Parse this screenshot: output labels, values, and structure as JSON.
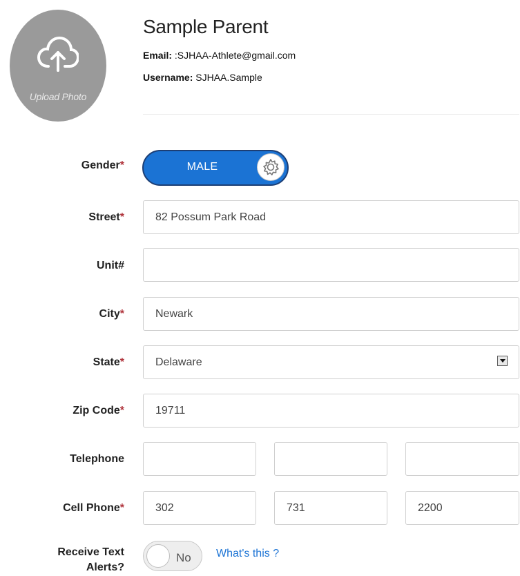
{
  "avatar": {
    "upload_label": "Upload Photo",
    "icon": "cloud-upload-icon"
  },
  "profile": {
    "name": "Sample Parent",
    "email_label": "Email:",
    "email_value": ":SJHAA-Athlete@gmail.com",
    "username_label": "Username:",
    "username_value": "SJHAA.Sample"
  },
  "form": {
    "gender": {
      "label": "Gender",
      "required_mark": "*",
      "value": "MALE",
      "icon": "gear-icon"
    },
    "street": {
      "label": "Street",
      "required_mark": "*",
      "value": "82 Possum Park Road"
    },
    "unit": {
      "label": "Unit#",
      "value": ""
    },
    "city": {
      "label": "City",
      "required_mark": "*",
      "value": "Newark"
    },
    "state": {
      "label": "State",
      "required_mark": "*",
      "value": "Delaware"
    },
    "zip": {
      "label": "Zip Code",
      "required_mark": "*",
      "value": "19711"
    },
    "telephone": {
      "label": "Telephone",
      "parts": [
        "",
        "",
        ""
      ]
    },
    "cell": {
      "label": "Cell Phone",
      "required_mark": "*",
      "parts": [
        "302",
        "731",
        "2200"
      ]
    },
    "text_alerts": {
      "label_line1": "Receive Text",
      "label_line2": "Alerts?",
      "value": "No",
      "help_link": "What's this ?"
    }
  },
  "colors": {
    "accent": "#1b73d4",
    "required": "#b0343c",
    "avatar_bg": "#9a9a9a"
  }
}
